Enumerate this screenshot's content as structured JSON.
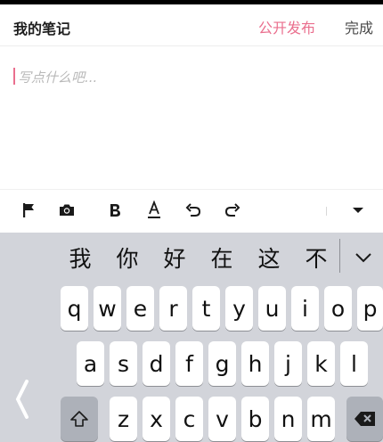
{
  "header": {
    "title": "我的笔记",
    "publish_label": "公开发布",
    "done_label": "完成"
  },
  "editor": {
    "placeholder": "写点什么吧..."
  },
  "toolbar": {
    "tools": [
      "flag-icon",
      "camera-icon",
      "bold-icon",
      "text-color-icon",
      "undo-icon",
      "redo-icon",
      "collapse-icon"
    ]
  },
  "keyboard": {
    "candidates": [
      "我",
      "你",
      "好",
      "在",
      "这",
      "不"
    ],
    "row1": [
      "q",
      "w",
      "e",
      "r",
      "t",
      "y",
      "u",
      "i",
      "o",
      "p"
    ],
    "row2": [
      "a",
      "s",
      "d",
      "f",
      "g",
      "h",
      "j",
      "k",
      "l"
    ],
    "row3": [
      "z",
      "x",
      "c",
      "v",
      "b",
      "n",
      "m"
    ]
  },
  "colors": {
    "accent": "#ea6f8e",
    "keyboard_bg": "#d2d4da",
    "key_bg": "#ffffff",
    "dark_key_bg": "#adb1b9"
  }
}
